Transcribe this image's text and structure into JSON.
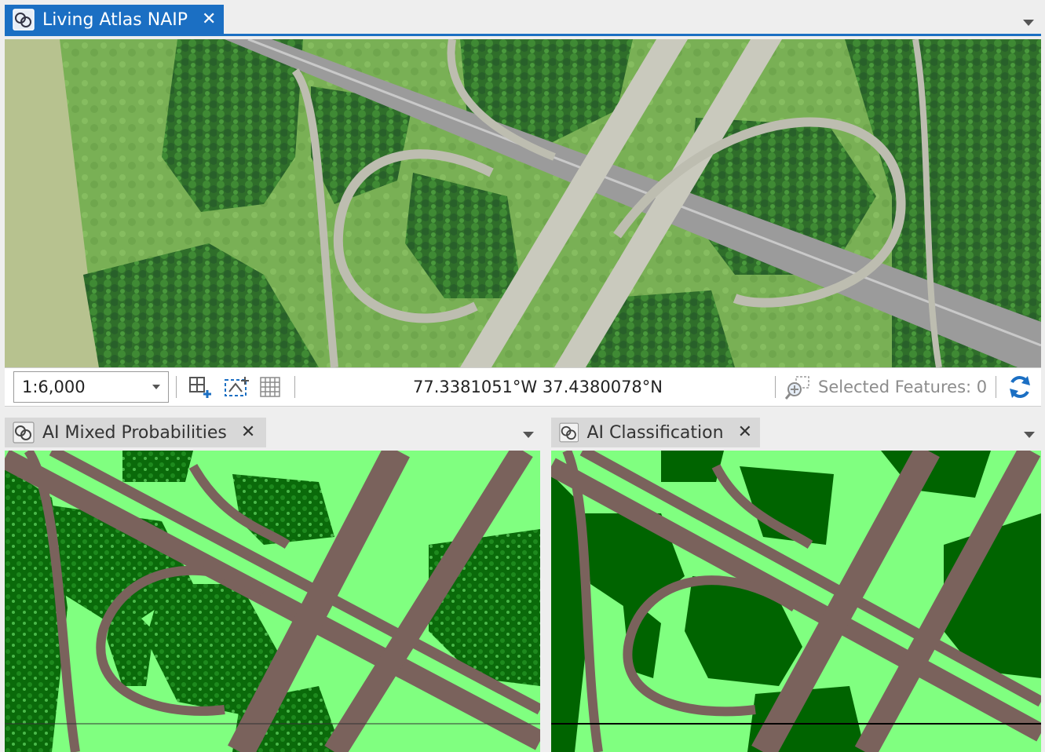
{
  "main_view": {
    "tab_label": "Living Atlas NAIP",
    "scale": "1:6,000",
    "coordinates": "77.3381051°W 37.4380078°N",
    "selected_features": "Selected Features: 0"
  },
  "left_view": {
    "tab_label": "AI Mixed Probabilities"
  },
  "right_view": {
    "tab_label": "AI Classification"
  },
  "colors": {
    "accent": "#1b6fc3",
    "road": "#7a625c",
    "light_vegetation": "#80ff80",
    "dark_vegetation": "#006400",
    "imagery_green": "#5f9b46"
  },
  "icons": [
    "map-view-icon",
    "close-icon",
    "dropdown-arrow-icon",
    "full-extent-icon",
    "adjust-extent-icon",
    "grid-icon",
    "selected-features-icon",
    "refresh-icon"
  ]
}
